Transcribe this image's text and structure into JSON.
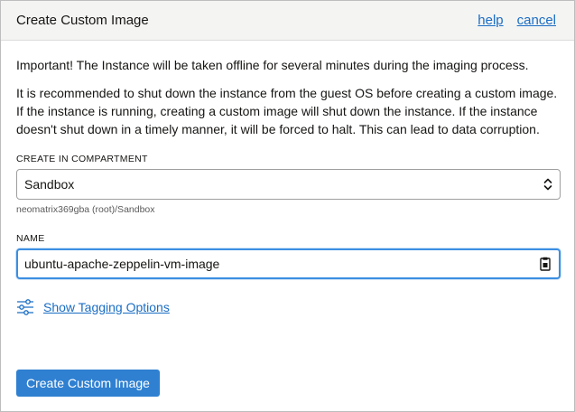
{
  "dialog": {
    "title": "Create Custom Image",
    "help_link": "help",
    "cancel_link": "cancel"
  },
  "content": {
    "important_text": "Important! The Instance will be taken offline for several minutes during the imaging process.",
    "recommendation_text": "It is recommended to shut down the instance from the guest OS before creating a custom image. If the instance is running, creating a custom image will shut down the instance. If the instance doesn't shut down in a timely manner, it will be forced to halt. This can lead to data corruption."
  },
  "compartment": {
    "label": "CREATE IN COMPARTMENT",
    "selected": "Sandbox",
    "path": "neomatrix369gba (root)/Sandbox"
  },
  "name_field": {
    "label": "NAME",
    "value": "ubuntu-apache-zeppelin-vm-image"
  },
  "tagging": {
    "link_label": "Show Tagging Options"
  },
  "actions": {
    "submit_label": "Create Custom Image"
  },
  "colors": {
    "link": "#1a6dc4",
    "primary_button": "#2f80d1",
    "focus_border": "#3b8fe2",
    "header_bg": "#f4f4f3"
  },
  "icons": {
    "select_caret": "chevron-up-down-icon",
    "input_action": "clipboard-icon",
    "tagging": "sliders-icon"
  }
}
